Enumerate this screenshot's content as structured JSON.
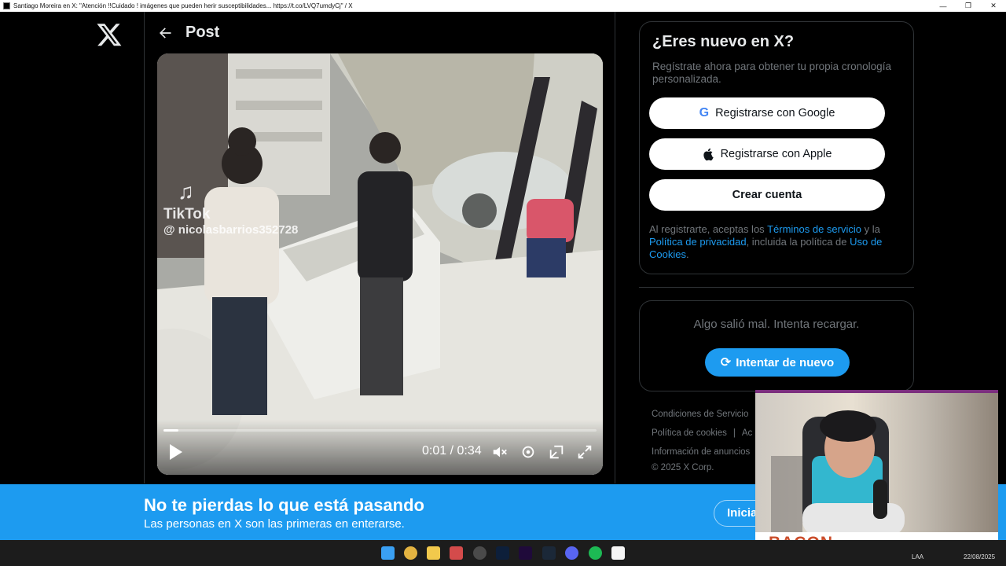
{
  "window": {
    "title": "Santiago Moreira en X: \"Atención !!Cuidado ! imágenes que pueden herir susceptibilidades... https://t.co/LVQ7umdyCj\" / X",
    "controls": [
      "minimize-icon",
      "restore-icon",
      "close-icon"
    ]
  },
  "header": {
    "logo": "x-logo-icon",
    "back_icon": "arrow-left-icon",
    "title": "Post"
  },
  "video": {
    "watermark": {
      "brand": "TikTok",
      "user": "@ nicolasbarrios352728"
    },
    "time": "0:01 / 0:34",
    "progress_fraction": 0.035,
    "controls": [
      "play-icon",
      "mute-icon",
      "settings-icon",
      "minimize-player-icon",
      "fullscreen-icon"
    ]
  },
  "signup": {
    "title": "¿Eres nuevo en X?",
    "subtitle": "Regístrate ahora para obtener tu propia cronología personalizada.",
    "google_label": "Registrarse con Google",
    "apple_label": "Registrarse con Apple",
    "create_label": "Crear cuenta",
    "terms_prefix": "Al registrarte, aceptas los ",
    "terms_link": "Términos de servicio",
    "terms_and": " y la ",
    "privacy_link": "Política de privacidad",
    "terms_middle": ", incluida la política de ",
    "cookies_link": "Uso de Cookies",
    "terms_end": "."
  },
  "error": {
    "message": "Algo salió mal. Intenta recargar.",
    "retry_label": "Intentar de nuevo"
  },
  "footer": {
    "links_row1": [
      "Condiciones de Servicio"
    ],
    "links_row2": [
      "Política de cookies",
      "Ac"
    ],
    "links_row3": [
      "Información de anuncios"
    ],
    "copyright": "© 2025 X Corp."
  },
  "banner": {
    "title": "No te pierdas lo que está pasando",
    "subtitle": "Las personas en X son las primeras en enterarse.",
    "login_label": "Inicia"
  },
  "overlay": {
    "webcam_label": "BACON"
  },
  "taskbar": {
    "apps": [
      "windows-start-icon",
      "chrome-icon",
      "file-explorer-icon",
      "snipping-tool-icon",
      "obs-icon",
      "photoshop-icon",
      "premiere-icon",
      "steam-icon",
      "discord-icon",
      "spotify-icon",
      "notion-icon"
    ],
    "language": "LAA",
    "date": "22/08/2025"
  },
  "colors": {
    "accent": "#1d9bf0",
    "background": "#000000",
    "border": "#2f3336",
    "muted_text": "#71767b",
    "webcam_brand": "#c94c2a"
  }
}
